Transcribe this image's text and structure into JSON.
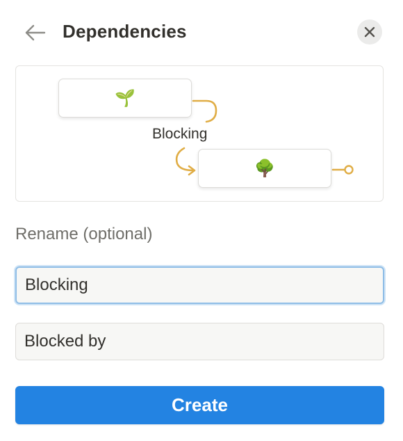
{
  "header": {
    "title": "Dependencies",
    "back_icon": "arrow-left-icon",
    "close_icon": "close-icon"
  },
  "diagram": {
    "node_top_icon": "🌱",
    "node_bottom_icon": "🌳",
    "relation_label": "Blocking",
    "connector_color": "#e0ad45"
  },
  "form": {
    "rename_label": "Rename (optional)",
    "field_blocking_value": "Blocking",
    "field_blocked_by_value": "Blocked by"
  },
  "actions": {
    "create_label": "Create",
    "create_color": "#2383e2"
  }
}
